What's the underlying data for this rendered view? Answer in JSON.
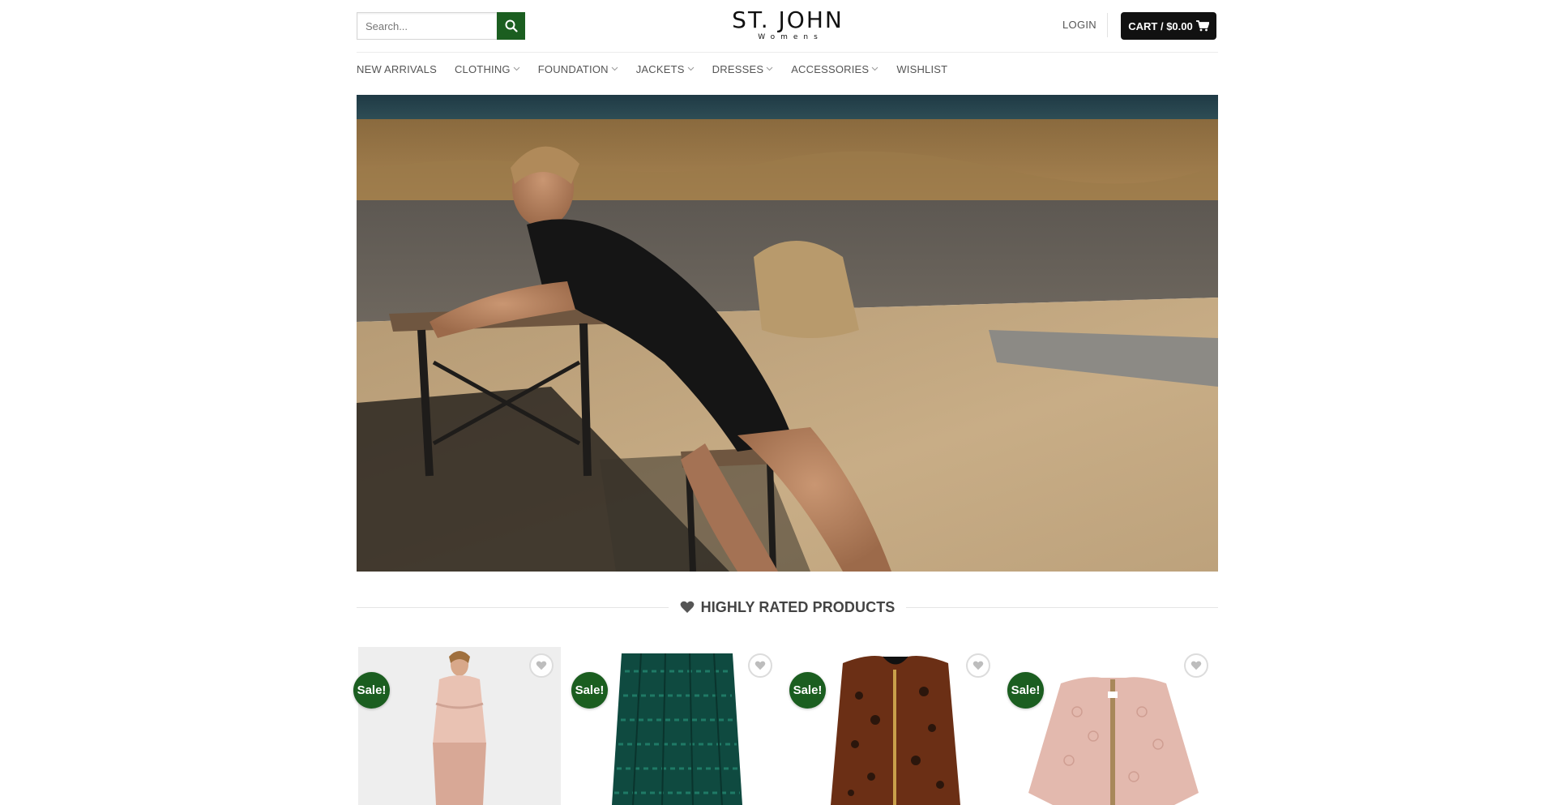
{
  "header": {
    "search": {
      "placeholder": "Search..."
    },
    "logo": {
      "main": "ST. JOHN",
      "sub": "Womens"
    },
    "login_label": "LOGIN",
    "cart_label": "CART / $0.00"
  },
  "nav": {
    "items": [
      {
        "label": "NEW ARRIVALS",
        "has_dropdown": false
      },
      {
        "label": "CLOTHING",
        "has_dropdown": true
      },
      {
        "label": "FOUNDATION",
        "has_dropdown": true
      },
      {
        "label": "JACKETS",
        "has_dropdown": true
      },
      {
        "label": "DRESSES",
        "has_dropdown": true
      },
      {
        "label": "ACCESSORIES",
        "has_dropdown": true
      },
      {
        "label": "WISHLIST",
        "has_dropdown": false
      }
    ]
  },
  "section": {
    "title": "HIGHLY RATED PRODUCTS",
    "icon": "heart-icon"
  },
  "products": [
    {
      "badge": "Sale!",
      "icon": "heart-icon"
    },
    {
      "badge": "Sale!",
      "icon": "heart-icon"
    },
    {
      "badge": "Sale!",
      "icon": "heart-icon"
    },
    {
      "badge": "Sale!",
      "icon": "heart-icon"
    }
  ],
  "colors": {
    "accent_green": "#1b5e20",
    "cart_bg": "#111111",
    "nav_text": "#555555"
  }
}
